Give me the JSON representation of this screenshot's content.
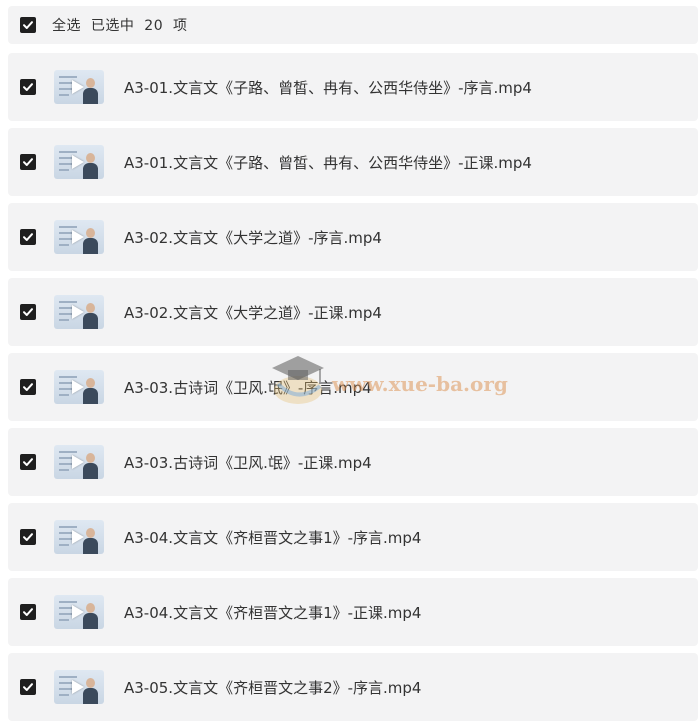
{
  "header": {
    "select_all_label": "全选  已选中  20  项"
  },
  "files": [
    {
      "name": "A3-01.文言文《子路、曾皙、冉有、公西华侍坐》-序言.mp4",
      "checked": true
    },
    {
      "name": "A3-01.文言文《子路、曾皙、冉有、公西华侍坐》-正课.mp4",
      "checked": true
    },
    {
      "name": "A3-02.文言文《大学之道》-序言.mp4",
      "checked": true
    },
    {
      "name": "A3-02.文言文《大学之道》-正课.mp4",
      "checked": true
    },
    {
      "name": "A3-03.古诗词《卫风.氓》-序言.mp4",
      "checked": true
    },
    {
      "name": "A3-03.古诗词《卫风.氓》-正课.mp4",
      "checked": true
    },
    {
      "name": "A3-04.文言文《齐桓晋文之事1》-序言.mp4",
      "checked": true
    },
    {
      "name": "A3-04.文言文《齐桓晋文之事1》-正课.mp4",
      "checked": true
    },
    {
      "name": "A3-05.文言文《齐桓晋文之事2》-序言.mp4",
      "checked": true
    }
  ],
  "watermark": {
    "text": "www.xue-ba.org"
  },
  "colors": {
    "row_bg": "#f3f3f4",
    "checkbox": "#1f1f1f",
    "text": "#333333"
  }
}
